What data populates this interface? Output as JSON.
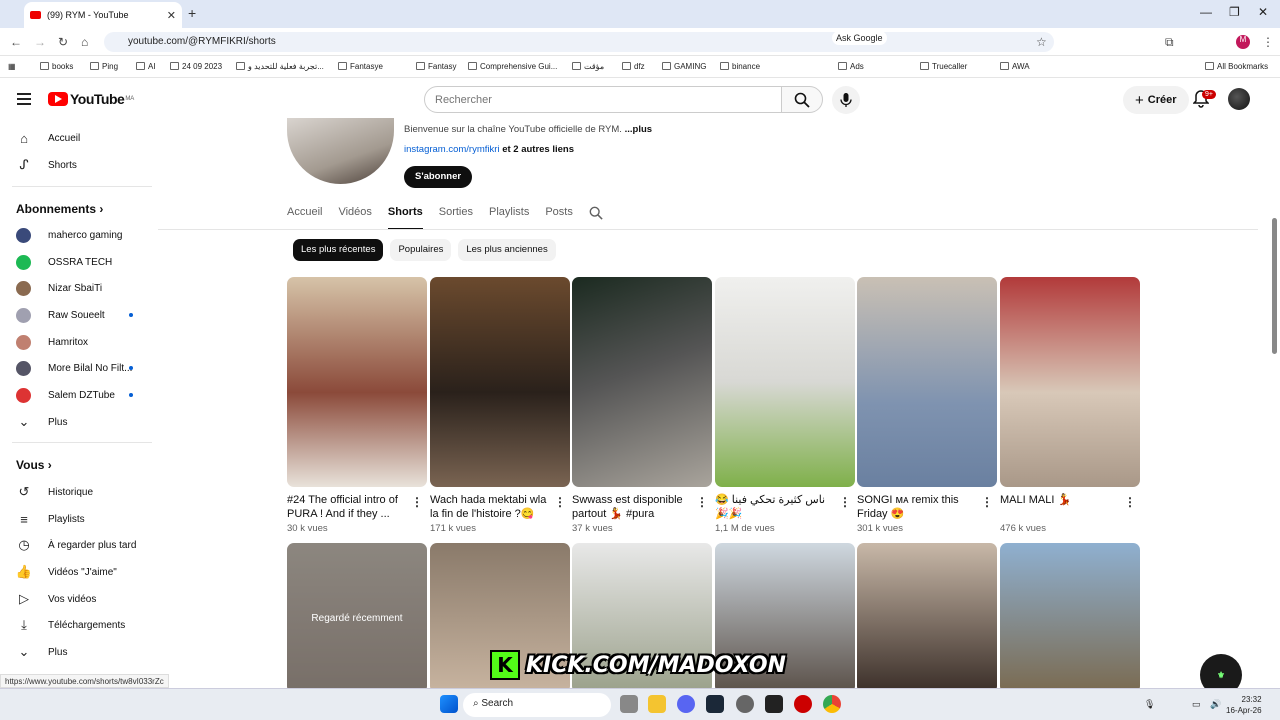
{
  "browser": {
    "tab_title": "(99) RYM - YouTube",
    "url": "youtube.com/@RYMFIKRI/shorts",
    "ask_google": "Ask Google",
    "bookmarks": [
      "books",
      "Ping",
      "AI",
      "24 09 2023",
      "تجربة فعلية للتحديد و...",
      "Fantasye",
      "Fantasy",
      "Comprehensive Gui...",
      "مؤقت",
      "dfz",
      "GAMING",
      "binance",
      "Ads",
      "Truecaller",
      "AWA"
    ],
    "all_bookmarks": "All Bookmarks",
    "status_url": "https://www.youtube.com/shorts/tw8vI033rZc"
  },
  "header": {
    "logo": "YouTube",
    "region": "MA",
    "search_placeholder": "Rechercher",
    "create_label": "Créer",
    "notif_count": "9+"
  },
  "sidebar": {
    "main": [
      {
        "label": "Accueil",
        "icon": "home-icon"
      },
      {
        "label": "Shorts",
        "icon": "shorts-icon"
      }
    ],
    "subs_heading": "Abonnements",
    "subs": [
      {
        "label": "maherco gaming",
        "color": "#3a4a7a",
        "dot": false
      },
      {
        "label": "OSSRA TECH",
        "color": "#1db954",
        "dot": false
      },
      {
        "label": "Nizar SbaiTi",
        "color": "#8a6a50",
        "dot": false
      },
      {
        "label": "Raw Soueelt",
        "color": "#a0a0b0",
        "dot": true
      },
      {
        "label": "Hamritox",
        "color": "#c08070",
        "dot": false
      },
      {
        "label": "More Bilal No Filt...",
        "color": "#556",
        "dot": true
      },
      {
        "label": "Salem DZTube",
        "color": "#d33",
        "dot": true
      },
      {
        "label": "Plus",
        "color": "",
        "dot": false
      }
    ],
    "you_heading": "Vous",
    "you": [
      {
        "label": "Historique",
        "icon": "history-icon"
      },
      {
        "label": "Playlists",
        "icon": "playlist-icon"
      },
      {
        "label": "À regarder plus tard",
        "icon": "clock-icon"
      },
      {
        "label": "Vidéos \"J'aime\"",
        "icon": "like-icon"
      },
      {
        "label": "Vos vidéos",
        "icon": "video-icon"
      },
      {
        "label": "Téléchargements",
        "icon": "download-icon"
      },
      {
        "label": "Plus",
        "icon": "chevron-down-icon"
      }
    ]
  },
  "channel": {
    "description": "Bienvenue sur la chaîne YouTube officielle de RYM.",
    "more": "...plus",
    "link": "instagram.com/rymfikri",
    "other_links": "et 2 autres liens",
    "subscribe": "S'abonner",
    "tabs": [
      "Accueil",
      "Vidéos",
      "Shorts",
      "Sorties",
      "Playlists",
      "Posts"
    ],
    "active_tab": "Shorts"
  },
  "chips": [
    "Les plus récentes",
    "Populaires",
    "Les plus anciennes"
  ],
  "shorts": [
    {
      "title": "#24 The official intro of PURA ! And if they ...",
      "views": "30 k vues",
      "bg": "linear-gradient(180deg,#d6c3a8,#8b4a3a 55%,#e8e2da)"
    },
    {
      "title": "Wach hada mektabi wla la fin de l'histoire ?😋",
      "views": "171 k vues",
      "bg": "linear-gradient(180deg,#6b4a2e,#2a211b 55%,#7a6452)"
    },
    {
      "title": "Swwass est disponible partout 💃 #pura",
      "views": "37 k vues",
      "bg": "linear-gradient(160deg,#1b2a20,#555 45%,#a9a49c)"
    },
    {
      "title": "ناس كثيرة تحكي فينا 😂🎉🎉",
      "views": "1,1 M de vues",
      "bg": "linear-gradient(180deg,#f0f0ee,#d8d8d4 50%,#7fb04a)"
    },
    {
      "title": "SONGI ᴍᴀ remix this Friday 😍",
      "views": "301 k vues",
      "bg": "linear-gradient(180deg,#c9c0b4,#7f93b0 60%,#6a80a0)"
    },
    {
      "title": "MALI MALI 💃",
      "views": "476 k vues",
      "bg": "linear-gradient(180deg,#b23a3a,#d8c8b8 55%,#a99888)"
    },
    {
      "title": "",
      "views": "",
      "bg": "linear-gradient(180deg,#d8cfc4,#b8aaa0)",
      "overlay": "Regardé récemment"
    },
    {
      "title": "",
      "views": "",
      "bg": "linear-gradient(180deg,#8a7a6a,#c8b4a0)"
    },
    {
      "title": "",
      "views": "",
      "bg": "linear-gradient(180deg,#e8e8e8,#9aa08a)"
    },
    {
      "title": "",
      "views": "",
      "bg": "linear-gradient(180deg,#cfd8e0,#5a5048)"
    },
    {
      "title": "",
      "views": "",
      "bg": "linear-gradient(180deg,#c8b8a8,#3a2e28)"
    },
    {
      "title": "",
      "views": "",
      "bg": "linear-gradient(180deg,#8fb0d0,#7a6a50)"
    }
  ],
  "overlay": {
    "kick": "KICK.COM/MADOXON"
  },
  "taskbar": {
    "search": "Search",
    "time": "23:32",
    "date": "16-Apr-26"
  }
}
